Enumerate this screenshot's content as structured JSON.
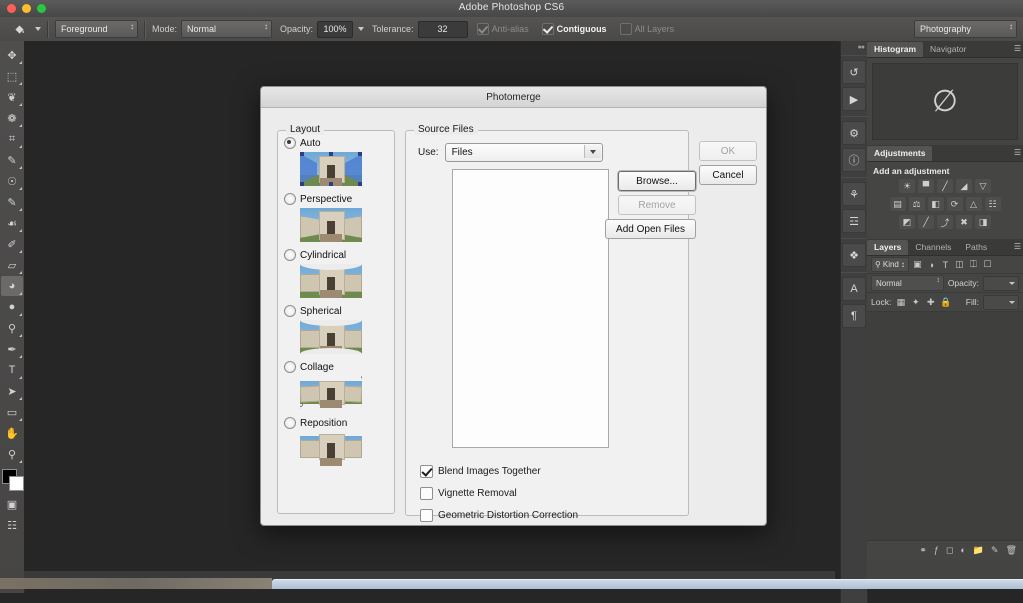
{
  "window": {
    "app_title": "Adobe Photoshop CS6",
    "traffic_lights": [
      "close-red",
      "minimize-yellow",
      "zoom-green"
    ]
  },
  "options_bar": {
    "tool_icon": "paint-bucket-icon",
    "preset_picker_arrow": "chevron-down-icon",
    "fill_source": {
      "value": "Foreground"
    },
    "mode": {
      "label": "Mode:",
      "value": "Normal"
    },
    "opacity": {
      "label": "Opacity:",
      "value": "100%"
    },
    "tolerance": {
      "label": "Tolerance:",
      "value": "32"
    },
    "anti_alias": {
      "label": "Anti-alias",
      "checked": true,
      "enabled": false
    },
    "contiguous": {
      "label": "Contiguous",
      "checked": true,
      "enabled": true
    },
    "all_layers": {
      "label": "All Layers",
      "checked": false,
      "enabled": false
    },
    "workspace": {
      "value": "Photography"
    }
  },
  "toolbar": {
    "tools": [
      {
        "name": "move-tool",
        "glyph": "✥"
      },
      {
        "name": "marquee-tool",
        "glyph": "⬚"
      },
      {
        "name": "lasso-tool",
        "glyph": "❦"
      },
      {
        "name": "quick-selection-tool",
        "glyph": "❁"
      },
      {
        "name": "crop-tool",
        "glyph": "⌗"
      },
      {
        "name": "eyedropper-tool",
        "glyph": "✒"
      },
      {
        "name": "spot-healing-brush-tool",
        "glyph": "☂"
      },
      {
        "name": "brush-tool",
        "glyph": "✎"
      },
      {
        "name": "clone-stamp-tool",
        "glyph": "⚓"
      },
      {
        "name": "history-brush-tool",
        "glyph": "✐"
      },
      {
        "name": "eraser-tool",
        "glyph": "▱"
      },
      {
        "name": "paint-bucket-tool",
        "glyph": "◕",
        "active": true
      },
      {
        "name": "blur-tool",
        "glyph": "●"
      },
      {
        "name": "dodge-tool",
        "glyph": "⚲"
      },
      {
        "name": "pen-tool",
        "glyph": "✒"
      },
      {
        "name": "type-tool",
        "glyph": "T"
      },
      {
        "name": "path-selection-tool",
        "glyph": "➤"
      },
      {
        "name": "rectangle-tool",
        "glyph": "▭"
      },
      {
        "name": "hand-tool",
        "glyph": "✋"
      },
      {
        "name": "zoom-tool",
        "glyph": "⚲"
      }
    ],
    "foreground_color": "#000000",
    "background_color": "#ffffff",
    "quick_mask": "quick-mask-icon",
    "screen_mode": "screen-mode-icon"
  },
  "dock_column": {
    "buttons": [
      {
        "name": "history-icon",
        "glyph": "↺"
      },
      {
        "name": "actions-play-icon",
        "glyph": "▶"
      },
      {
        "name": "properties-icon",
        "glyph": "⚙"
      },
      {
        "name": "info-icon",
        "glyph": "ℹ"
      },
      {
        "name": "color-icon",
        "glyph": "☘"
      },
      {
        "name": "swatches-icon",
        "glyph": "☲"
      },
      {
        "name": "styles-icon",
        "glyph": "❖"
      },
      {
        "name": "character-icon",
        "glyph": "A"
      },
      {
        "name": "paragraph-icon",
        "glyph": "¶"
      }
    ]
  },
  "panels": {
    "histogram": {
      "tabs": [
        {
          "label": "Histogram",
          "active": true
        },
        {
          "label": "Navigator",
          "active": false
        }
      ],
      "empty_glyph": "∅"
    },
    "adjustments": {
      "tab_label": "Adjustments",
      "title": "Add an adjustment",
      "rows": [
        [
          "☀",
          "▀",
          "╱",
          "◢",
          "▽"
        ],
        [
          "▤",
          "⚖",
          "◧",
          "⟳",
          "△",
          "☷"
        ],
        [
          "◩",
          "╱",
          "⤴",
          "✖",
          "◨"
        ]
      ]
    },
    "layers": {
      "tabs": [
        {
          "label": "Layers",
          "active": true
        },
        {
          "label": "Channels",
          "active": false
        },
        {
          "label": "Paths",
          "active": false
        }
      ],
      "filter": {
        "search_icon": "search-icon",
        "kind_label": "Kind"
      },
      "filter_icons": [
        "pixel-layer-icon",
        "adjustment-layer-icon",
        "type-layer-icon",
        "shape-layer-icon",
        "smart-object-icon"
      ],
      "blend_mode": "Normal",
      "opacity_label": "Opacity:",
      "lock_label": "Lock:",
      "lock_icons": [
        "lock-transparent-pixels-icon",
        "lock-image-pixels-icon",
        "lock-position-icon",
        "lock-all-icon"
      ],
      "fill_label": "Fill:",
      "footer_icons": [
        "link-layers-icon",
        "layer-style-icon",
        "layer-mask-icon",
        "new-fill-layer-icon",
        "new-group-icon",
        "new-layer-icon",
        "delete-layer-icon"
      ]
    }
  },
  "dialog": {
    "title": "Photomerge",
    "layout": {
      "legend": "Layout",
      "options": [
        {
          "label": "Auto",
          "selected": true,
          "thumb": "auto"
        },
        {
          "label": "Perspective",
          "selected": false,
          "thumb": "perspective"
        },
        {
          "label": "Cylindrical",
          "selected": false,
          "thumb": "cylindrical"
        },
        {
          "label": "Spherical",
          "selected": false,
          "thumb": "spherical"
        },
        {
          "label": "Collage",
          "selected": false,
          "thumb": "collage"
        },
        {
          "label": "Reposition",
          "selected": false,
          "thumb": "reposition"
        }
      ]
    },
    "source_files": {
      "legend": "Source Files",
      "use_label": "Use:",
      "use_value": "Files",
      "file_list": [],
      "buttons": [
        {
          "label": "Browse...",
          "name": "browse-button",
          "enabled": true,
          "focused": true
        },
        {
          "label": "Remove",
          "name": "remove-button",
          "enabled": false,
          "focused": false
        },
        {
          "label": "Add Open Files",
          "name": "add-open-files-button",
          "enabled": true,
          "focused": false
        }
      ],
      "checkboxes": [
        {
          "label": "Blend Images Together",
          "checked": true
        },
        {
          "label": "Vignette Removal",
          "checked": false
        },
        {
          "label": "Geometric Distortion Correction",
          "checked": false
        }
      ]
    },
    "actions": [
      {
        "label": "OK",
        "name": "ok-button",
        "enabled": false
      },
      {
        "label": "Cancel",
        "name": "cancel-button",
        "enabled": true
      }
    ]
  }
}
